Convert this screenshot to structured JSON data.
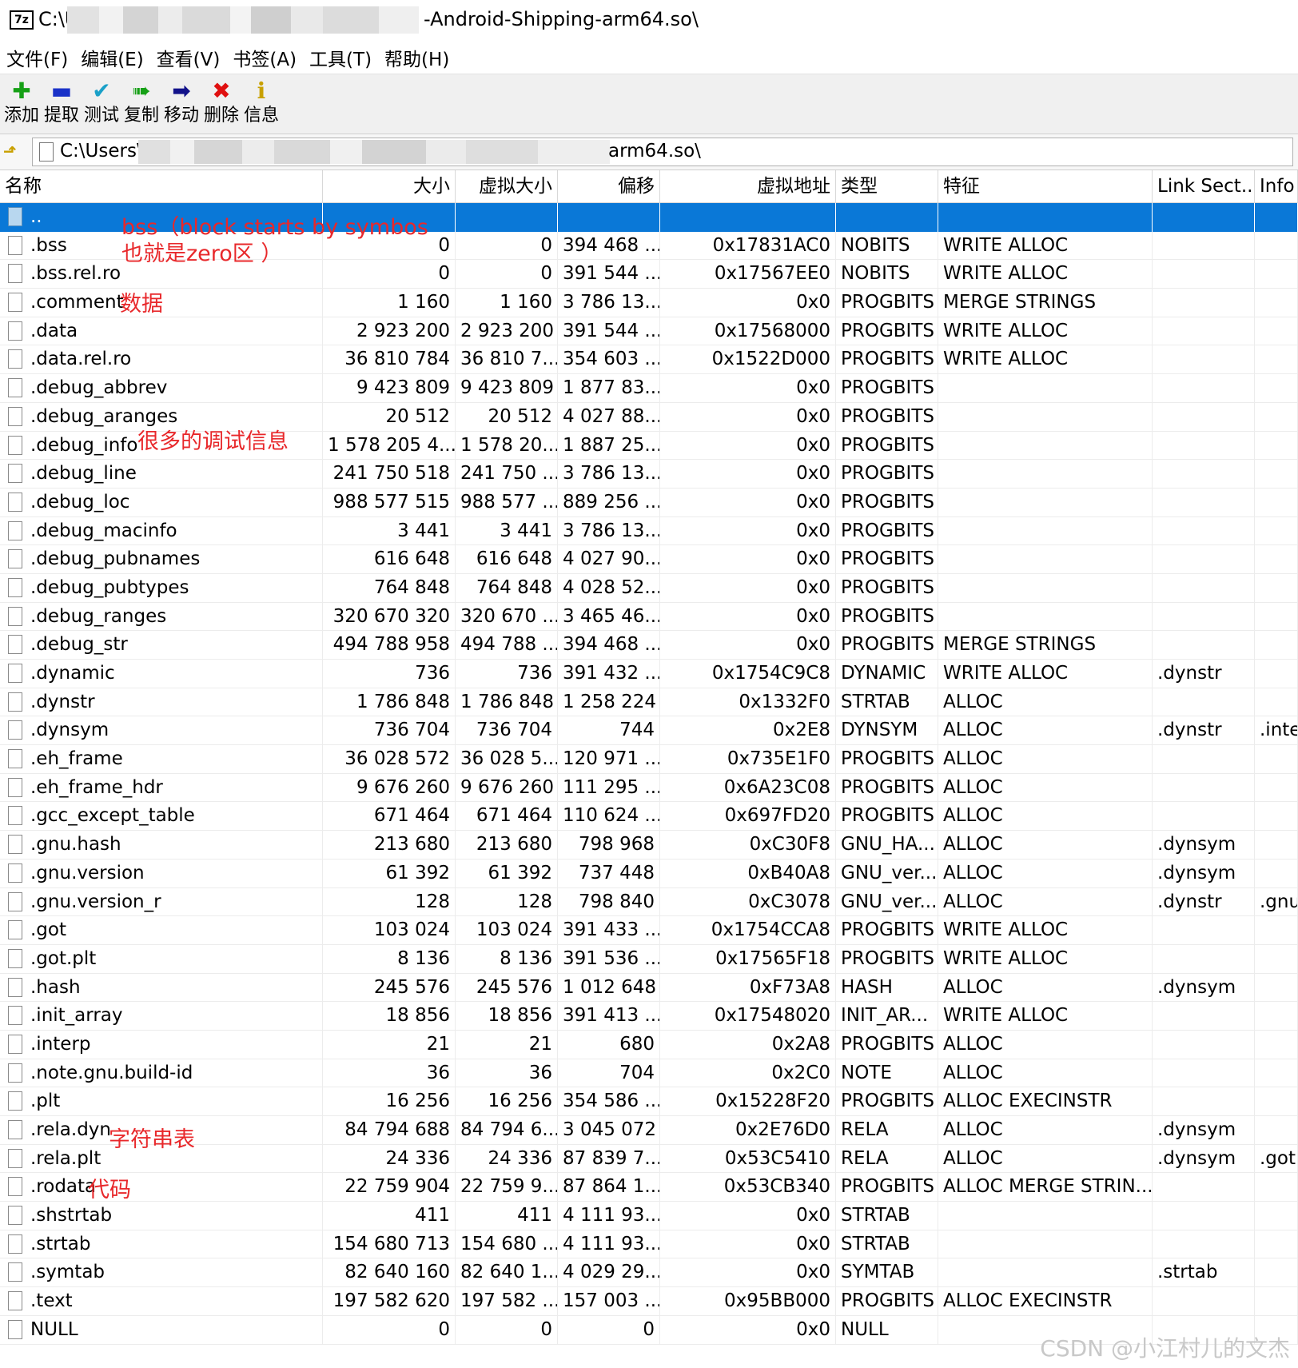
{
  "window": {
    "title_prefix": "C:\\U",
    "title_suffix": "-Android-Shipping-arm64.so\\",
    "logo_text": "7z"
  },
  "menu": [
    "文件(F)",
    "编辑(E)",
    "查看(V)",
    "书签(A)",
    "工具(T)",
    "帮助(H)"
  ],
  "toolbar": [
    {
      "label": "添加",
      "icon": "add-icon",
      "glyph": "✚",
      "color": "#16a016"
    },
    {
      "label": "提取",
      "icon": "extract-icon",
      "glyph": "▬",
      "color": "#1a32c8"
    },
    {
      "label": "测试",
      "icon": "test-icon",
      "glyph": "✔",
      "color": "#1aa0c8"
    },
    {
      "label": "复制",
      "icon": "copy-icon",
      "glyph": "➠",
      "color": "#16a016"
    },
    {
      "label": "移动",
      "icon": "move-icon",
      "glyph": "➡",
      "color": "#12128a"
    },
    {
      "label": "删除",
      "icon": "delete-icon",
      "glyph": "✖",
      "color": "#e01010"
    },
    {
      "label": "信息",
      "icon": "info-icon",
      "glyph": "ℹ",
      "color": "#c8a000"
    }
  ],
  "address": {
    "prefix": "C:\\Users\\",
    "suffix": "arm64.so\\"
  },
  "columns": [
    "名称",
    "大小",
    "虚拟大小",
    "偏移",
    "虚拟地址",
    "类型",
    "特征",
    "Link Sect...",
    "Info"
  ],
  "rows": [
    {
      "name": "..",
      "size": "",
      "vsize": "",
      "offset": "",
      "vaddr": "",
      "type": "",
      "flags": "",
      "link": "",
      "info": ""
    },
    {
      "name": ".bss",
      "size": "0",
      "vsize": "0",
      "offset": "394 468 ...",
      "vaddr": "0x17831AC0",
      "type": "NOBITS",
      "flags": "WRITE ALLOC",
      "link": "",
      "info": ""
    },
    {
      "name": ".bss.rel.ro",
      "size": "0",
      "vsize": "0",
      "offset": "391 544 ...",
      "vaddr": "0x17567EE0",
      "type": "NOBITS",
      "flags": "WRITE ALLOC",
      "link": "",
      "info": ""
    },
    {
      "name": ".comment",
      "size": "1 160",
      "vsize": "1 160",
      "offset": "3 786 13...",
      "vaddr": "0x0",
      "type": "PROGBITS",
      "flags": "MERGE STRINGS",
      "link": "",
      "info": ""
    },
    {
      "name": ".data",
      "size": "2 923 200",
      "vsize": "2 923 200",
      "offset": "391 544 ...",
      "vaddr": "0x17568000",
      "type": "PROGBITS",
      "flags": "WRITE ALLOC",
      "link": "",
      "info": ""
    },
    {
      "name": ".data.rel.ro",
      "size": "36 810 784",
      "vsize": "36 810 7...",
      "offset": "354 603 ...",
      "vaddr": "0x1522D000",
      "type": "PROGBITS",
      "flags": "WRITE ALLOC",
      "link": "",
      "info": ""
    },
    {
      "name": ".debug_abbrev",
      "size": "9 423 809",
      "vsize": "9 423 809",
      "offset": "1 877 83...",
      "vaddr": "0x0",
      "type": "PROGBITS",
      "flags": "",
      "link": "",
      "info": ""
    },
    {
      "name": ".debug_aranges",
      "size": "20 512",
      "vsize": "20 512",
      "offset": "4 027 88...",
      "vaddr": "0x0",
      "type": "PROGBITS",
      "flags": "",
      "link": "",
      "info": ""
    },
    {
      "name": ".debug_info",
      "size": "1 578 205 4...",
      "vsize": "1 578 20...",
      "offset": "1 887 25...",
      "vaddr": "0x0",
      "type": "PROGBITS",
      "flags": "",
      "link": "",
      "info": ""
    },
    {
      "name": ".debug_line",
      "size": "241 750 518",
      "vsize": "241 750 ...",
      "offset": "3 786 13...",
      "vaddr": "0x0",
      "type": "PROGBITS",
      "flags": "",
      "link": "",
      "info": ""
    },
    {
      "name": ".debug_loc",
      "size": "988 577 515",
      "vsize": "988 577 ...",
      "offset": "889 256 ...",
      "vaddr": "0x0",
      "type": "PROGBITS",
      "flags": "",
      "link": "",
      "info": ""
    },
    {
      "name": ".debug_macinfo",
      "size": "3 441",
      "vsize": "3 441",
      "offset": "3 786 13...",
      "vaddr": "0x0",
      "type": "PROGBITS",
      "flags": "",
      "link": "",
      "info": ""
    },
    {
      "name": ".debug_pubnames",
      "size": "616 648",
      "vsize": "616 648",
      "offset": "4 027 90...",
      "vaddr": "0x0",
      "type": "PROGBITS",
      "flags": "",
      "link": "",
      "info": ""
    },
    {
      "name": ".debug_pubtypes",
      "size": "764 848",
      "vsize": "764 848",
      "offset": "4 028 52...",
      "vaddr": "0x0",
      "type": "PROGBITS",
      "flags": "",
      "link": "",
      "info": ""
    },
    {
      "name": ".debug_ranges",
      "size": "320 670 320",
      "vsize": "320 670 ...",
      "offset": "3 465 46...",
      "vaddr": "0x0",
      "type": "PROGBITS",
      "flags": "",
      "link": "",
      "info": ""
    },
    {
      "name": ".debug_str",
      "size": "494 788 958",
      "vsize": "494 788 ...",
      "offset": "394 468 ...",
      "vaddr": "0x0",
      "type": "PROGBITS",
      "flags": "MERGE STRINGS",
      "link": "",
      "info": ""
    },
    {
      "name": ".dynamic",
      "size": "736",
      "vsize": "736",
      "offset": "391 432 ...",
      "vaddr": "0x1754C9C8",
      "type": "DYNAMIC",
      "flags": "WRITE ALLOC",
      "link": ".dynstr",
      "info": ""
    },
    {
      "name": ".dynstr",
      "size": "1 786 848",
      "vsize": "1 786 848",
      "offset": "1 258 224",
      "vaddr": "0x1332F0",
      "type": "STRTAB",
      "flags": "ALLOC",
      "link": "",
      "info": ""
    },
    {
      "name": ".dynsym",
      "size": "736 704",
      "vsize": "736 704",
      "offset": "744",
      "vaddr": "0x2E8",
      "type": "DYNSYM",
      "flags": "ALLOC",
      "link": ".dynstr",
      "info": ".inte"
    },
    {
      "name": ".eh_frame",
      "size": "36 028 572",
      "vsize": "36 028 5...",
      "offset": "120 971 ...",
      "vaddr": "0x735E1F0",
      "type": "PROGBITS",
      "flags": "ALLOC",
      "link": "",
      "info": ""
    },
    {
      "name": ".eh_frame_hdr",
      "size": "9 676 260",
      "vsize": "9 676 260",
      "offset": "111 295 ...",
      "vaddr": "0x6A23C08",
      "type": "PROGBITS",
      "flags": "ALLOC",
      "link": "",
      "info": ""
    },
    {
      "name": ".gcc_except_table",
      "size": "671 464",
      "vsize": "671 464",
      "offset": "110 624 ...",
      "vaddr": "0x697FD20",
      "type": "PROGBITS",
      "flags": "ALLOC",
      "link": "",
      "info": ""
    },
    {
      "name": ".gnu.hash",
      "size": "213 680",
      "vsize": "213 680",
      "offset": "798 968",
      "vaddr": "0xC30F8",
      "type": "GNU_HA...",
      "flags": "ALLOC",
      "link": ".dynsym",
      "info": ""
    },
    {
      "name": ".gnu.version",
      "size": "61 392",
      "vsize": "61 392",
      "offset": "737 448",
      "vaddr": "0xB40A8",
      "type": "GNU_ver...",
      "flags": "ALLOC",
      "link": ".dynsym",
      "info": ""
    },
    {
      "name": ".gnu.version_r",
      "size": "128",
      "vsize": "128",
      "offset": "798 840",
      "vaddr": "0xC3078",
      "type": "GNU_ver...",
      "flags": "ALLOC",
      "link": ".dynstr",
      "info": ".gnu"
    },
    {
      "name": ".got",
      "size": "103 024",
      "vsize": "103 024",
      "offset": "391 433 ...",
      "vaddr": "0x1754CCA8",
      "type": "PROGBITS",
      "flags": "WRITE ALLOC",
      "link": "",
      "info": ""
    },
    {
      "name": ".got.plt",
      "size": "8 136",
      "vsize": "8 136",
      "offset": "391 536 ...",
      "vaddr": "0x17565F18",
      "type": "PROGBITS",
      "flags": "WRITE ALLOC",
      "link": "",
      "info": ""
    },
    {
      "name": ".hash",
      "size": "245 576",
      "vsize": "245 576",
      "offset": "1 012 648",
      "vaddr": "0xF73A8",
      "type": "HASH",
      "flags": "ALLOC",
      "link": ".dynsym",
      "info": ""
    },
    {
      "name": ".init_array",
      "size": "18 856",
      "vsize": "18 856",
      "offset": "391 413 ...",
      "vaddr": "0x17548020",
      "type": "INIT_AR...",
      "flags": "WRITE ALLOC",
      "link": "",
      "info": ""
    },
    {
      "name": ".interp",
      "size": "21",
      "vsize": "21",
      "offset": "680",
      "vaddr": "0x2A8",
      "type": "PROGBITS",
      "flags": "ALLOC",
      "link": "",
      "info": ""
    },
    {
      "name": ".note.gnu.build-id",
      "size": "36",
      "vsize": "36",
      "offset": "704",
      "vaddr": "0x2C0",
      "type": "NOTE",
      "flags": "ALLOC",
      "link": "",
      "info": ""
    },
    {
      "name": ".plt",
      "size": "16 256",
      "vsize": "16 256",
      "offset": "354 586 ...",
      "vaddr": "0x15228F20",
      "type": "PROGBITS",
      "flags": "ALLOC EXECINSTR",
      "link": "",
      "info": ""
    },
    {
      "name": ".rela.dyn",
      "size": "84 794 688",
      "vsize": "84 794 6...",
      "offset": "3 045 072",
      "vaddr": "0x2E76D0",
      "type": "RELA",
      "flags": "ALLOC",
      "link": ".dynsym",
      "info": ""
    },
    {
      "name": ".rela.plt",
      "size": "24 336",
      "vsize": "24 336",
      "offset": "87 839 7...",
      "vaddr": "0x53C5410",
      "type": "RELA",
      "flags": "ALLOC",
      "link": ".dynsym",
      "info": ".got."
    },
    {
      "name": ".rodata",
      "size": "22 759 904",
      "vsize": "22 759 9...",
      "offset": "87 864 1...",
      "vaddr": "0x53CB340",
      "type": "PROGBITS",
      "flags": "ALLOC MERGE STRIN...",
      "link": "",
      "info": ""
    },
    {
      "name": ".shstrtab",
      "size": "411",
      "vsize": "411",
      "offset": "4 111 93...",
      "vaddr": "0x0",
      "type": "STRTAB",
      "flags": "",
      "link": "",
      "info": ""
    },
    {
      "name": ".strtab",
      "size": "154 680 713",
      "vsize": "154 680 ...",
      "offset": "4 111 93...",
      "vaddr": "0x0",
      "type": "STRTAB",
      "flags": "",
      "link": "",
      "info": ""
    },
    {
      "name": ".symtab",
      "size": "82 640 160",
      "vsize": "82 640 1...",
      "offset": "4 029 29...",
      "vaddr": "0x0",
      "type": "SYMTAB",
      "flags": "",
      "link": ".strtab",
      "info": ""
    },
    {
      "name": ".text",
      "size": "197 582 620",
      "vsize": "197 582 ...",
      "offset": "157 003 ...",
      "vaddr": "0x95BB000",
      "type": "PROGBITS",
      "flags": "ALLOC EXECINSTR",
      "link": "",
      "info": ""
    },
    {
      "name": "NULL",
      "size": "0",
      "vsize": "0",
      "offset": "0",
      "vaddr": "0x0",
      "type": "NULL",
      "flags": "",
      "link": "",
      "info": ""
    }
  ],
  "annotations": [
    {
      "text": "bss（block starts by symbos",
      "row": 1
    },
    {
      "text": "也就是zero区 ）",
      "row": 2
    },
    {
      "text": "数据",
      "row": 4
    },
    {
      "text": "很多的调试信息",
      "row": 9
    },
    {
      "text": "字符串表",
      "row": 36
    },
    {
      "text": "代码",
      "row": 38
    }
  ],
  "watermark": "CSDN @小江村儿的文杰",
  "colors": {
    "selection": "#0a78d7",
    "annotation": "#e8282b"
  }
}
